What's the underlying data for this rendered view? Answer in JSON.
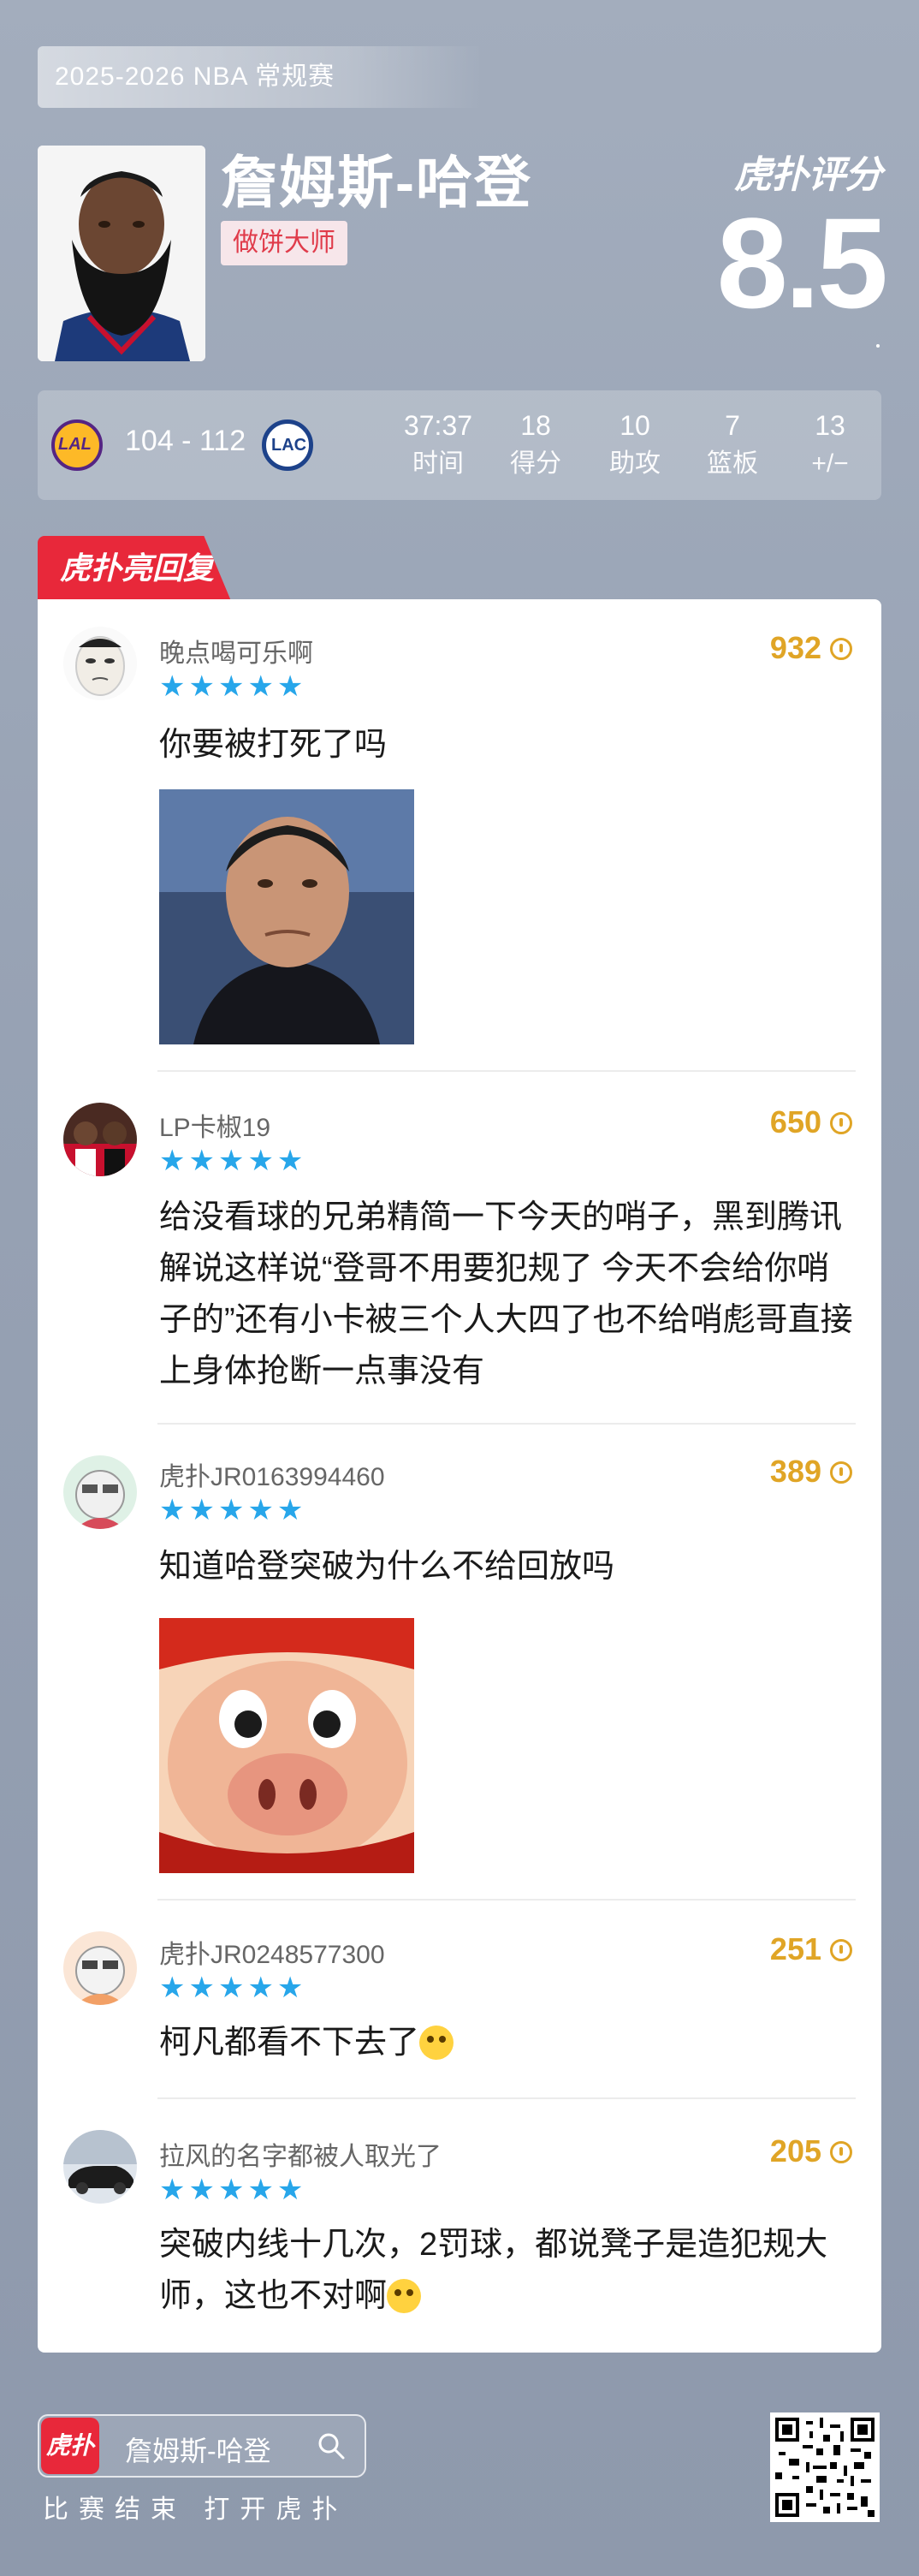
{
  "header": {
    "season": "2025-2026 NBA 常规赛",
    "player_name": "詹姆斯-哈登",
    "player_title": "做饼大师",
    "brand": "虎扑评分",
    "rating": "8.5"
  },
  "game": {
    "home_team": "LAL",
    "away_team": "LAC",
    "score": "104 - 112",
    "stats": [
      {
        "value": "37:37",
        "label": "时间"
      },
      {
        "value": "18",
        "label": "得分"
      },
      {
        "value": "10",
        "label": "助攻"
      },
      {
        "value": "7",
        "label": "篮板"
      },
      {
        "value": "13",
        "label": "+/−"
      }
    ]
  },
  "section_title": "虎扑亮回复",
  "comments": [
    {
      "user": "晚点喝可乐啊",
      "stars": "★★★★★",
      "likes": "932",
      "text": "你要被打死了吗"
    },
    {
      "user": "LP卡椒19",
      "stars": "★★★★★",
      "likes": "650",
      "text": "给没看球的兄弟精简一下今天的哨子，黑到腾讯解说这样说“登哥不用要犯规了 今天不会给你哨子的”还有小卡被三个人大四了也不给哨彪哥直接上身体抢断一点事没有"
    },
    {
      "user": "虎扑JR0163994460",
      "stars": "★★★★★",
      "likes": "389",
      "text": "知道哈登突破为什么不给回放吗"
    },
    {
      "user": "虎扑JR0248577300",
      "stars": "★★★★★",
      "likes": "251",
      "text": "柯凡都看不下去了"
    },
    {
      "user": "拉风的名字都被人取光了",
      "stars": "★★★★★",
      "likes": "205",
      "text": "突破内线十几次，2罚球，都说凳子是造犯规大师，这也不对啊"
    }
  ],
  "footer": {
    "search_logo": "虎扑",
    "search_text": "詹姆斯-哈登",
    "cta": "比赛结束 打开虎扑"
  }
}
